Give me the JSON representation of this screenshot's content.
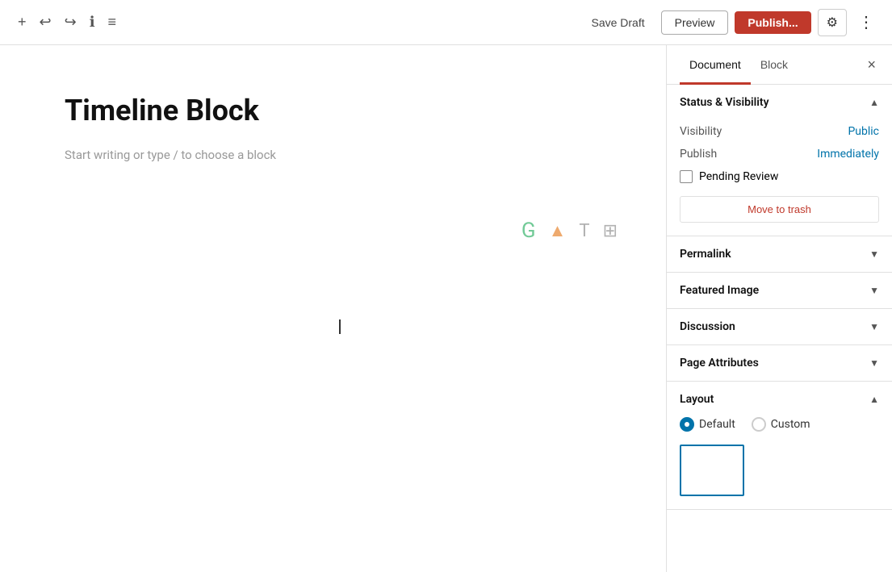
{
  "toolbar": {
    "save_draft_label": "Save Draft",
    "preview_label": "Preview",
    "publish_label": "Publish...",
    "add_icon": "+",
    "undo_icon": "↩",
    "redo_icon": "↪",
    "info_icon": "ℹ",
    "list_icon": "≡",
    "settings_icon": "⚙",
    "more_icon": "⋮"
  },
  "editor": {
    "title": "Timeline Block",
    "placeholder": "Start writing or type / to choose a block"
  },
  "sidebar": {
    "tabs": [
      {
        "label": "Document",
        "active": true
      },
      {
        "label": "Block",
        "active": false
      }
    ],
    "close_label": "×",
    "sections": {
      "status_visibility": {
        "title": "Status & Visibility",
        "expanded": true,
        "visibility_label": "Visibility",
        "visibility_value": "Public",
        "publish_label": "Publish",
        "publish_value": "Immediately",
        "pending_review_label": "Pending Review",
        "trash_label": "Move to trash"
      },
      "permalink": {
        "title": "Permalink",
        "expanded": false
      },
      "featured_image": {
        "title": "Featured Image",
        "expanded": false
      },
      "discussion": {
        "title": "Discussion",
        "expanded": false
      },
      "page_attributes": {
        "title": "Page Attributes",
        "expanded": false
      },
      "layout": {
        "title": "Layout",
        "expanded": true,
        "options": [
          {
            "label": "Default",
            "checked": true
          },
          {
            "label": "Custom",
            "checked": false
          }
        ]
      }
    }
  }
}
